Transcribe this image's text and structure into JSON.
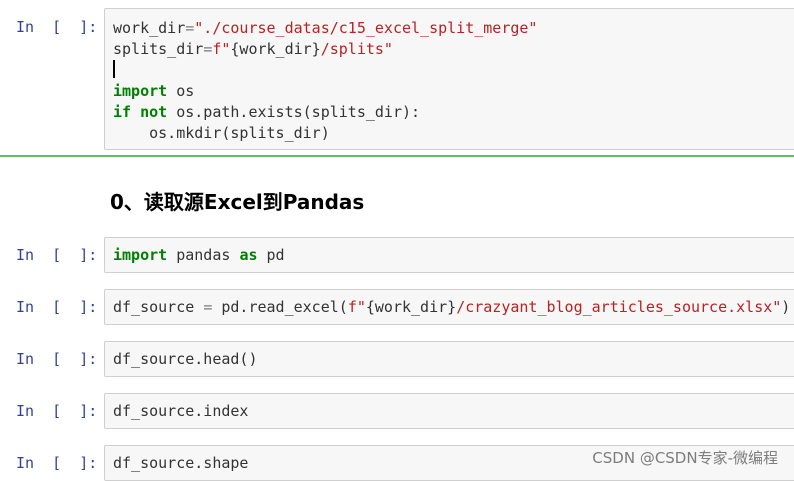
{
  "cells": {
    "c1": {
      "prompt": "In  [  ]:",
      "lines": {
        "l1": {
          "a": "work_dir",
          "b": "=",
          "c": "\"./course_datas/c15_excel_split_merge\""
        },
        "l2": {
          "a": "splits_dir",
          "b": "=",
          "c": "f\"",
          "d": "{work_dir}",
          "e": "/splits\""
        },
        "l4": {
          "kw": "import",
          "rest": " os"
        },
        "l5": {
          "kw1": "if",
          "kw2": " not",
          "rest": " os.path.exists(splits_dir):"
        },
        "l6": {
          "rest": "    os.mkdir(splits_dir)"
        }
      }
    },
    "heading": "0、读取源Excel到Pandas",
    "c2": {
      "prompt": "In  [  ]:",
      "kw1": "import",
      "mid": " pandas ",
      "kw2": "as",
      "rest": " pd"
    },
    "c3": {
      "prompt": "In  [  ]:",
      "a": "df_source ",
      "b": "=",
      "c": " pd.read_excel(",
      "d": "f\"",
      "e": "{work_dir}",
      "f": "/crazyant_blog_articles_source.xlsx\"",
      "g": ")"
    },
    "c4": {
      "prompt": "In  [  ]:",
      "code": "df_source.head()"
    },
    "c5": {
      "prompt": "In  [  ]:",
      "code": "df_source.index"
    },
    "c6": {
      "prompt": "In  [  ]:",
      "code": "df_source.shape"
    }
  },
  "watermark": "CSDN @CSDN专家-微编程",
  "colors": {
    "keyword": "#008000",
    "string": "#ba2121",
    "prompt": "#303f9f",
    "selected": "#66bb6a"
  }
}
